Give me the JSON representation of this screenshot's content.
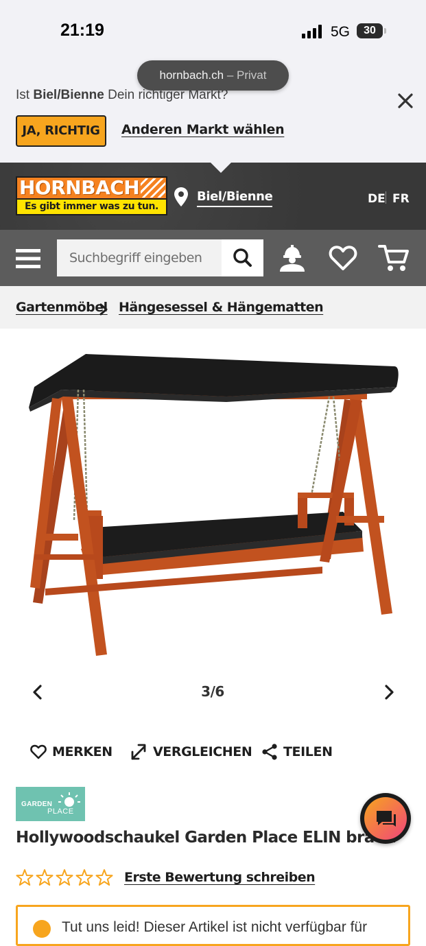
{
  "status_bar": {
    "time": "21:19",
    "network": "5G",
    "battery": "30"
  },
  "browser": {
    "domain": "hornbach.ch",
    "mode": "– Privat"
  },
  "store_banner": {
    "question_prefix": "Ist ",
    "store_name": "Biel/Bienne",
    "question_suffix": " Dein richtiger Markt?",
    "confirm_label": "JA, RICHTIG",
    "change_label": "Anderen Markt wählen"
  },
  "header": {
    "logo_name": "HORNBACH",
    "logo_slogan": "Es gibt immer was zu tun.",
    "store_link": "Biel/Bienne",
    "languages": [
      "DE",
      "FR"
    ]
  },
  "search": {
    "placeholder": "Suchbegriff eingeben"
  },
  "breadcrumb": [
    "Gartenmöbel",
    "Hängesessel & Hängematten"
  ],
  "gallery": {
    "counter": "3/6"
  },
  "actions": {
    "save": "MERKEN",
    "compare": "VERGLEICHEN",
    "share": "TEILEN"
  },
  "product": {
    "brand_logo_text": "GARDEN",
    "brand_logo_sub": "PLACE",
    "title": "Hollywoodschaukel Garden Place ELIN braun",
    "rating_stars": 0,
    "review_link": "Erste Bewertung schreiben"
  },
  "notice": {
    "text": "Tut uns leid! Dieser Artikel ist nicht verfügbar für"
  },
  "colors": {
    "accent": "#f7a51e",
    "header_dark": "#3b3b3b",
    "nav_grey": "#5c5c5c",
    "brand_teal": "#6fc2b0"
  }
}
